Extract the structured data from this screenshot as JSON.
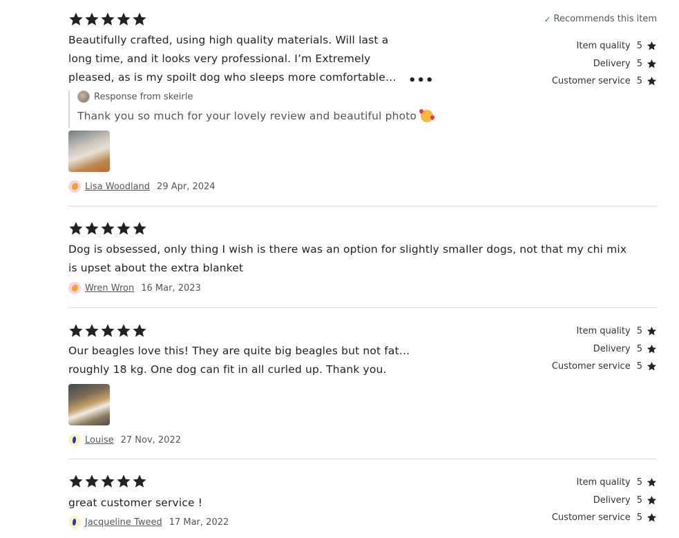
{
  "reviews": [
    {
      "rating": 5,
      "text_lines": [
        "Beautifully crafted, using high quality materials. Will last a",
        "long time, and it looks very professional. I’m Extremely",
        "pleased, as is my spoilt dog who sleeps more comfortable…"
      ],
      "more_label": "•••",
      "recommends": "Recommends this item",
      "sub_ratings": [
        {
          "label": "Item quality",
          "value": "5"
        },
        {
          "label": "Delivery",
          "value": "5"
        },
        {
          "label": "Customer service",
          "value": "5"
        }
      ],
      "response": {
        "header": "Response from skeirle",
        "text": "Thank you so much for your lovely review and beautiful photo"
      },
      "reviewer": "Lisa Woodland",
      "date": "29 Apr, 2024"
    },
    {
      "rating": 5,
      "text_lines": [
        "Dog is obsessed, only thing I wish is there was an option for slightly smaller dogs, not that my chi mix",
        "is upset about the extra blanket"
      ],
      "reviewer": "Wren Wron",
      "date": "16 Mar, 2023"
    },
    {
      "rating": 5,
      "text_lines": [
        "Our beagles love this! They are quite big beagles but not fat…",
        "roughly 18 kg. One dog can fit in all curled up. Thank you."
      ],
      "sub_ratings": [
        {
          "label": "Item quality",
          "value": "5"
        },
        {
          "label": "Delivery",
          "value": "5"
        },
        {
          "label": "Customer service",
          "value": "5"
        }
      ],
      "reviewer": "Louise",
      "date": "27 Nov, 2022"
    },
    {
      "rating": 5,
      "text_lines": [
        "great customer service !"
      ],
      "sub_ratings": [
        {
          "label": "Item quality",
          "value": "5"
        },
        {
          "label": "Delivery",
          "value": "5"
        },
        {
          "label": "Customer service",
          "value": "5"
        }
      ],
      "reviewer": "Jacqueline Tweed",
      "date": "17 Mar, 2022"
    }
  ]
}
